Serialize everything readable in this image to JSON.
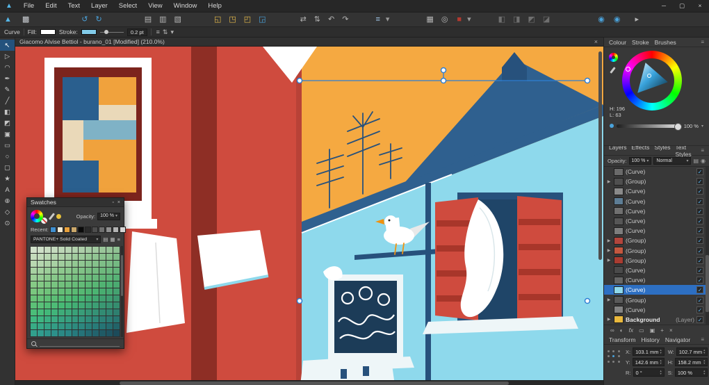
{
  "window": {
    "minimize_icon": "─",
    "maximize_icon": "▢",
    "close_icon": "×"
  },
  "menubar": {
    "app_icon": "▲",
    "menus": [
      "File",
      "Edit",
      "Text",
      "Layer",
      "Select",
      "View",
      "Window",
      "Help"
    ]
  },
  "toolbar": {
    "icons": [
      {
        "name": "designer-persona-icon",
        "glyph": "▲",
        "color": "#56b8e9",
        "ml": "4px"
      },
      {
        "name": "pixel-persona-icon",
        "glyph": "▩",
        "color": "#c9cdd2",
        "ml": "8px"
      },
      {
        "name": "undo-icon",
        "glyph": "↺",
        "color": "#4aa3dc",
        "ml": "68px"
      },
      {
        "name": "redo-icon",
        "glyph": "↻",
        "color": "#4aa3dc",
        "ml": "4px"
      },
      {
        "name": "document-setup-icon",
        "glyph": "▤",
        "color": "#b5b5b5",
        "ml": "54px"
      },
      {
        "name": "clipboard-icon",
        "glyph": "▥",
        "color": "#b5b5b5",
        "ml": "4px"
      },
      {
        "name": "export-icon",
        "glyph": "▧",
        "color": "#b5b5b5",
        "ml": "4px"
      },
      {
        "name": "insert-behind-icon",
        "glyph": "◱",
        "color": "#e9bc4b",
        "ml": "40px"
      },
      {
        "name": "insert-inside-icon",
        "glyph": "◳",
        "color": "#e9bc4b",
        "ml": "4px"
      },
      {
        "name": "insert-on-top-icon",
        "glyph": "◰",
        "color": "#e9bc4b",
        "ml": "4px"
      },
      {
        "name": "replace-selection-icon",
        "glyph": "◲",
        "color": "#4aa3dc",
        "ml": "4px"
      },
      {
        "name": "flip-horizontal-icon",
        "glyph": "⇄",
        "color": "#b5b5b5",
        "ml": "42px"
      },
      {
        "name": "flip-vertical-icon",
        "glyph": "⇅",
        "color": "#b5b5b5",
        "ml": "4px"
      },
      {
        "name": "rotate-ccw-icon",
        "glyph": "↶",
        "color": "#b5b5b5",
        "ml": "4px"
      },
      {
        "name": "rotate-cw-icon",
        "glyph": "↷",
        "color": "#b5b5b5",
        "ml": "4px"
      },
      {
        "name": "snapping-icon",
        "glyph": "≡",
        "color": "#9fc6e8",
        "ml": "32px"
      },
      {
        "name": "snapping-caret-icon",
        "glyph": "▾",
        "color": "#999999",
        "ml": "1px"
      },
      {
        "name": "grid-icon",
        "glyph": "▦",
        "color": "#b5b5b5",
        "ml": "46px"
      },
      {
        "name": "preview-mode-icon",
        "glyph": "◎",
        "color": "#b5b5b5",
        "ml": "4px"
      },
      {
        "name": "fill-well-icon",
        "glyph": "■",
        "color": "#b23a30",
        "ml": "6px"
      },
      {
        "name": "fill-well-caret-icon",
        "glyph": "▾",
        "color": "#999999",
        "ml": "1px"
      },
      {
        "name": "align-left-icon",
        "glyph": "◧",
        "color": "#6f6f6f",
        "ml": "32px"
      },
      {
        "name": "align-center-icon",
        "glyph": "◨",
        "color": "#6f6f6f",
        "ml": "4px"
      },
      {
        "name": "align-top-icon",
        "glyph": "◩",
        "color": "#6f6f6f",
        "ml": "4px"
      },
      {
        "name": "align-bottom-icon",
        "glyph": "◪",
        "color": "#6f6f6f",
        "ml": "4px"
      },
      {
        "name": "color-sync-icon",
        "glyph": "◉",
        "color": "#4aa3dc",
        "ml": "62px"
      },
      {
        "name": "help-icon",
        "glyph": "◉",
        "color": "#4aa3dc",
        "ml": "6px"
      },
      {
        "name": "panels-toggle-icon",
        "glyph": "▸",
        "color": "#b5b5b5",
        "ml": "14px"
      }
    ]
  },
  "context_toolbar": {
    "tool": "Curve",
    "fill_label": "Fill:",
    "fill_color": "#ffffff",
    "stroke_label": "Stroke:",
    "stroke_color": "#82cbe9",
    "stroke_width": "0.2 pt",
    "icons": [
      {
        "name": "stroke-properties-icon",
        "glyph": "≡"
      },
      {
        "name": "stroke-order-icon",
        "glyph": "⇅"
      },
      {
        "name": "snap-options-icon",
        "glyph": "▾"
      }
    ]
  },
  "tools": {
    "items": [
      {
        "name": "move-tool",
        "glyph": "↖",
        "cls": "active"
      },
      {
        "name": "node-tool",
        "glyph": "▷"
      },
      {
        "name": "corner-tool",
        "glyph": "◠"
      },
      {
        "name": "pen-tool",
        "glyph": "✒"
      },
      {
        "name": "pencil-tool",
        "glyph": "✎"
      },
      {
        "name": "vector-brush-tool",
        "glyph": "╱"
      },
      {
        "name": "fill-tool",
        "glyph": "◧"
      },
      {
        "name": "transparency-tool",
        "glyph": "◩"
      },
      {
        "name": "vector-crop-tool",
        "glyph": "▣"
      },
      {
        "name": "rectangle-tool",
        "glyph": "▭"
      },
      {
        "name": "ellipse-tool",
        "glyph": "○"
      },
      {
        "name": "rounded-rectangle-tool",
        "glyph": "▢"
      },
      {
        "name": "star-tool",
        "glyph": "★"
      },
      {
        "name": "artistic-text-tool",
        "glyph": "A"
      },
      {
        "name": "color-picker-tool",
        "glyph": "⊕"
      },
      {
        "name": "view-tool",
        "glyph": "◇"
      },
      {
        "name": "zoom-tool",
        "glyph": "⊙"
      }
    ]
  },
  "document": {
    "title": "Giacomo Alvise Bettiol - burano_01 [Modified] (210.0%)",
    "close_icon": "×"
  },
  "artwork_palette": {
    "red": "#cf4b3e",
    "edge_red": "#b84237",
    "dark_red": "#8e2e25",
    "maroon": "#7c241d",
    "orange": "#f5a941",
    "light_blue": "#8ed9ec",
    "mid_blue": "#2f608f",
    "navy": "#27517c",
    "deep_navy": "#1c3c58",
    "white": "#ffffff",
    "off_white": "#eef6f8",
    "tile_orange": "#f0a23d",
    "tile_blue": "#2a5f8e",
    "cream": "#ead9b9",
    "steel": "#7fb2c6",
    "stripe_red": "#a8362a",
    "beak_orange": "#f0920f",
    "accent": "#2f7fd4"
  },
  "swatches": {
    "title": "Swatches",
    "dot_icon": "▫",
    "close_icon": "×",
    "opacity_label": "Opacity:",
    "opacity_value": "100 %",
    "caret": "▾",
    "accent_dot_color": "#e8c23a",
    "recent_label": "Recent:",
    "recent": [
      "#3f8fd0",
      "#f4ead4",
      "#e8a13c",
      "#caa76a",
      "#0a0a0a",
      "#2b2b2b",
      "#4d4d4d",
      "#6f6f6f",
      "#919191",
      "#b3b3b3",
      "#d5d5d5"
    ],
    "palette": "PANTONE+ Solid Coated",
    "palette_icons": [
      {
        "name": "swatch-options-icon",
        "glyph": "▤"
      },
      {
        "name": "swatch-grid-icon",
        "glyph": "▦"
      },
      {
        "name": "swatch-menu-icon",
        "glyph": "≡"
      }
    ],
    "cells": [
      "hsl(100,28%,84%)",
      "hsl(102,28%,83%)",
      "hsl(104,28%,81%)",
      "hsl(106,28%,80%)",
      "hsl(108,28%,78%)",
      "hsl(110,28%,77%)",
      "hsl(112,28%,75%)",
      "hsl(114,28%,74%)",
      "hsl(116,28%,72%)",
      "hsl(118,28%,71%)",
      "hsl(120,28%,69%)",
      "hsl(122,28%,68%)",
      "hsl(124,28%,66%)",
      "hsl(104,31%,80%)",
      "hsl(106,31%,79%)",
      "hsl(108,31%,77%)",
      "hsl(110,31%,76%)",
      "hsl(112,31%,74%)",
      "hsl(114,31%,73%)",
      "hsl(116,31%,71%)",
      "hsl(118,31%,70%)",
      "hsl(120,31%,68%)",
      "hsl(122,31%,67%)",
      "hsl(124,31%,65%)",
      "hsl(126,31%,64%)",
      "hsl(128,31%,62%)",
      "hsl(108,33%,77%)",
      "hsl(110,33%,76%)",
      "hsl(112,33%,74%)",
      "hsl(114,33%,73%)",
      "hsl(116,33%,71%)",
      "hsl(118,33%,70%)",
      "hsl(120,33%,68%)",
      "hsl(122,33%,67%)",
      "hsl(124,33%,65%)",
      "hsl(126,33%,64%)",
      "hsl(128,33%,62%)",
      "hsl(130,33%,61%)",
      "hsl(132,33%,59%)",
      "hsl(112,35%,73%)",
      "hsl(114,35%,72%)",
      "hsl(116,35%,70%)",
      "hsl(118,35%,69%)",
      "hsl(120,35%,67%)",
      "hsl(122,35%,66%)",
      "hsl(124,35%,64%)",
      "hsl(126,35%,63%)",
      "hsl(128,35%,61%)",
      "hsl(130,35%,60%)",
      "hsl(132,35%,58%)",
      "hsl(134,35%,57%)",
      "hsl(136,35%,55%)",
      "hsl(116,37%,70%)",
      "hsl(118,37%,69%)",
      "hsl(120,37%,67%)",
      "hsl(122,37%,66%)",
      "hsl(124,37%,64%)",
      "hsl(126,37%,63%)",
      "hsl(128,37%,61%)",
      "hsl(130,37%,60%)",
      "hsl(132,37%,58%)",
      "hsl(134,37%,57%)",
      "hsl(136,37%,55%)",
      "hsl(138,37%,54%)",
      "hsl(140,37%,52%)",
      "hsl(120,39%,66%)",
      "hsl(122,39%,65%)",
      "hsl(124,39%,63%)",
      "hsl(126,39%,62%)",
      "hsl(128,39%,60%)",
      "hsl(130,39%,59%)",
      "hsl(132,39%,57%)",
      "hsl(134,39%,56%)",
      "hsl(136,39%,54%)",
      "hsl(138,39%,53%)",
      "hsl(140,39%,51%)",
      "hsl(142,39%,50%)",
      "hsl(144,39%,48%)",
      "hsl(124,41%,63%)",
      "hsl(126,41%,62%)",
      "hsl(128,41%,60%)",
      "hsl(130,41%,59%)",
      "hsl(132,41%,57%)",
      "hsl(134,41%,56%)",
      "hsl(136,41%,54%)",
      "hsl(138,41%,53%)",
      "hsl(140,41%,51%)",
      "hsl(142,41%,50%)",
      "hsl(144,41%,48%)",
      "hsl(146,41%,47%)",
      "hsl(148,41%,45%)",
      "hsl(130,43%,59%)",
      "hsl(132,43%,58%)",
      "hsl(134,43%,56%)",
      "hsl(136,43%,55%)",
      "hsl(138,43%,53%)",
      "hsl(140,43%,52%)",
      "hsl(142,43%,50%)",
      "hsl(144,43%,49%)",
      "hsl(146,43%,47%)",
      "hsl(148,43%,46%)",
      "hsl(150,43%,44%)",
      "hsl(152,43%,43%)",
      "hsl(154,43%,41%)",
      "hsl(136,45%,56%)",
      "hsl(138,45%,55%)",
      "hsl(140,45%,53%)",
      "hsl(142,45%,52%)",
      "hsl(144,45%,50%)",
      "hsl(146,45%,49%)",
      "hsl(148,45%,47%)",
      "hsl(150,45%,46%)",
      "hsl(152,45%,44%)",
      "hsl(154,45%,43%)",
      "hsl(156,45%,41%)",
      "hsl(158,45%,40%)",
      "hsl(160,45%,38%)",
      "hsl(144,47%,52%)",
      "hsl(146,47%,51%)",
      "hsl(148,47%,49%)",
      "hsl(150,47%,48%)",
      "hsl(152,47%,46%)",
      "hsl(154,47%,45%)",
      "hsl(156,47%,43%)",
      "hsl(158,47%,42%)",
      "hsl(160,47%,40%)",
      "hsl(162,47%,39%)",
      "hsl(164,47%,37%)",
      "hsl(166,47%,36%)",
      "hsl(168,47%,34%)",
      "hsl(152,49%,49%)",
      "hsl(154,49%,48%)",
      "hsl(156,49%,46%)",
      "hsl(158,49%,45%)",
      "hsl(160,49%,43%)",
      "hsl(162,49%,42%)",
      "hsl(164,49%,40%)",
      "hsl(166,49%,39%)",
      "hsl(168,49%,37%)",
      "hsl(170,49%,36%)",
      "hsl(172,49%,34%)",
      "hsl(174,49%,33%)",
      "hsl(176,49%,31%)",
      "hsl(160,51%,45%)",
      "hsl(162,51%,44%)",
      "hsl(164,51%,42%)",
      "hsl(166,51%,41%)",
      "hsl(168,51%,39%)",
      "hsl(170,51%,38%)",
      "hsl(172,51%,36%)",
      "hsl(174,51%,35%)",
      "hsl(176,51%,33%)",
      "hsl(178,51%,32%)",
      "hsl(180,51%,30%)",
      "hsl(182,51%,29%)",
      "hsl(184,51%,27%)",
      "hsl(170,53%,41%)",
      "hsl(172,53%,40%)",
      "hsl(174,53%,38%)",
      "hsl(176,53%,37%)",
      "hsl(178,53%,35%)",
      "hsl(180,53%,34%)",
      "hsl(182,53%,32%)",
      "hsl(184,53%,31%)",
      "hsl(186,53%,29%)",
      "hsl(188,53%,28%)",
      "hsl(190,53%,26%)",
      "hsl(192,53%,25%)",
      "hsl(194,53%,23%)"
    ]
  },
  "color_panel": {
    "tabs": [
      "Colour",
      "Stroke",
      "Brushes"
    ],
    "menu_icon": "≡",
    "hue_readout": "H: 196",
    "lum_readout": "L: 63",
    "opacity_value": "100 %",
    "caret": "▾"
  },
  "layers_panel": {
    "tabs": [
      "Layers",
      "Effects",
      "Styles",
      "Text Styles"
    ],
    "menu_icon": "≡",
    "opacity_label": "Opacity:",
    "opacity_value": "100 %",
    "blend_mode": "Normal",
    "caret": "▾",
    "gear_icon": "▤",
    "lock_icon": "◉",
    "items": [
      {
        "arrow": "",
        "name": "(Curve)",
        "thumb": "#6a6a6a",
        "check": "✓"
      },
      {
        "arrow": "▶",
        "name": "(Group)",
        "thumb": "#4f4f4f",
        "check": "✓"
      },
      {
        "arrow": "",
        "name": "(Curve)",
        "thumb": "#8a8a8a",
        "check": "✓"
      },
      {
        "arrow": "",
        "name": "(Curve)",
        "thumb": "#5d7d95",
        "check": "✓"
      },
      {
        "arrow": "",
        "name": "(Curve)",
        "thumb": "#707070",
        "check": "✓"
      },
      {
        "arrow": "",
        "name": "(Curve)",
        "thumb": "#565656",
        "check": "✓"
      },
      {
        "arrow": "",
        "name": "(Curve)",
        "thumb": "#7d7d7d",
        "check": "✓"
      },
      {
        "arrow": "▶",
        "name": "(Group)",
        "thumb": "#b3453c",
        "check": "✓"
      },
      {
        "arrow": "▶",
        "name": "(Group)",
        "thumb": "#c4573f",
        "check": "✓"
      },
      {
        "arrow": "▶",
        "name": "(Group)",
        "thumb": "#a93c31",
        "check": "✓"
      },
      {
        "arrow": "",
        "name": "(Curve)",
        "thumb": "#4a4a4a",
        "check": "✓"
      },
      {
        "arrow": "",
        "name": "(Curve)",
        "thumb": "#656565",
        "check": "✓"
      },
      {
        "arrow": "",
        "name": "(Curve)",
        "thumb": "#8fd8ea",
        "check": "✓",
        "rowcls": "selected"
      },
      {
        "arrow": "▶",
        "name": "(Group)",
        "thumb": "#595959",
        "check": "✓"
      },
      {
        "arrow": "",
        "name": "(Curve)",
        "thumb": "#838383",
        "check": "✓"
      },
      {
        "arrow": "▶",
        "name": "Background",
        "suffix": " (Layer)",
        "thumb": "#eab93d",
        "check": "✓",
        "rowcls": "bg"
      }
    ],
    "footer_icons": [
      {
        "name": "link-layer-icon",
        "glyph": "∞"
      },
      {
        "name": "adjustment-icon",
        "glyph": "◐"
      },
      {
        "name": "layer-effects-icon",
        "glyph": "fx",
        "cls": "fx"
      },
      {
        "name": "mask-icon",
        "glyph": "▭"
      },
      {
        "name": "group-layers-icon",
        "glyph": "▣"
      },
      {
        "name": "add-layer-icon",
        "glyph": "+"
      },
      {
        "name": "delete-layer-icon",
        "glyph": "×"
      }
    ]
  },
  "transform_panel": {
    "tabs": [
      "Transform",
      "History",
      "Navigator"
    ],
    "menu_icon": "≡",
    "fields": [
      {
        "label": "X:",
        "value": "103.1 mm",
        "up": "▴",
        "dn": "▾"
      },
      {
        "label": "W:",
        "value": "102.7 mm",
        "up": "▴",
        "dn": "▾"
      },
      {
        "label": "Y:",
        "value": "142.6 mm",
        "up": "▴",
        "dn": "▾"
      },
      {
        "label": "H:",
        "value": "158.2 mm",
        "up": "▴",
        "dn": "▾"
      },
      {
        "label": "R:",
        "value": "0 °",
        "up": "▴",
        "dn": "▾"
      },
      {
        "label": "S:",
        "value": "100 %",
        "up": "▴",
        "dn": "▾"
      }
    ]
  }
}
